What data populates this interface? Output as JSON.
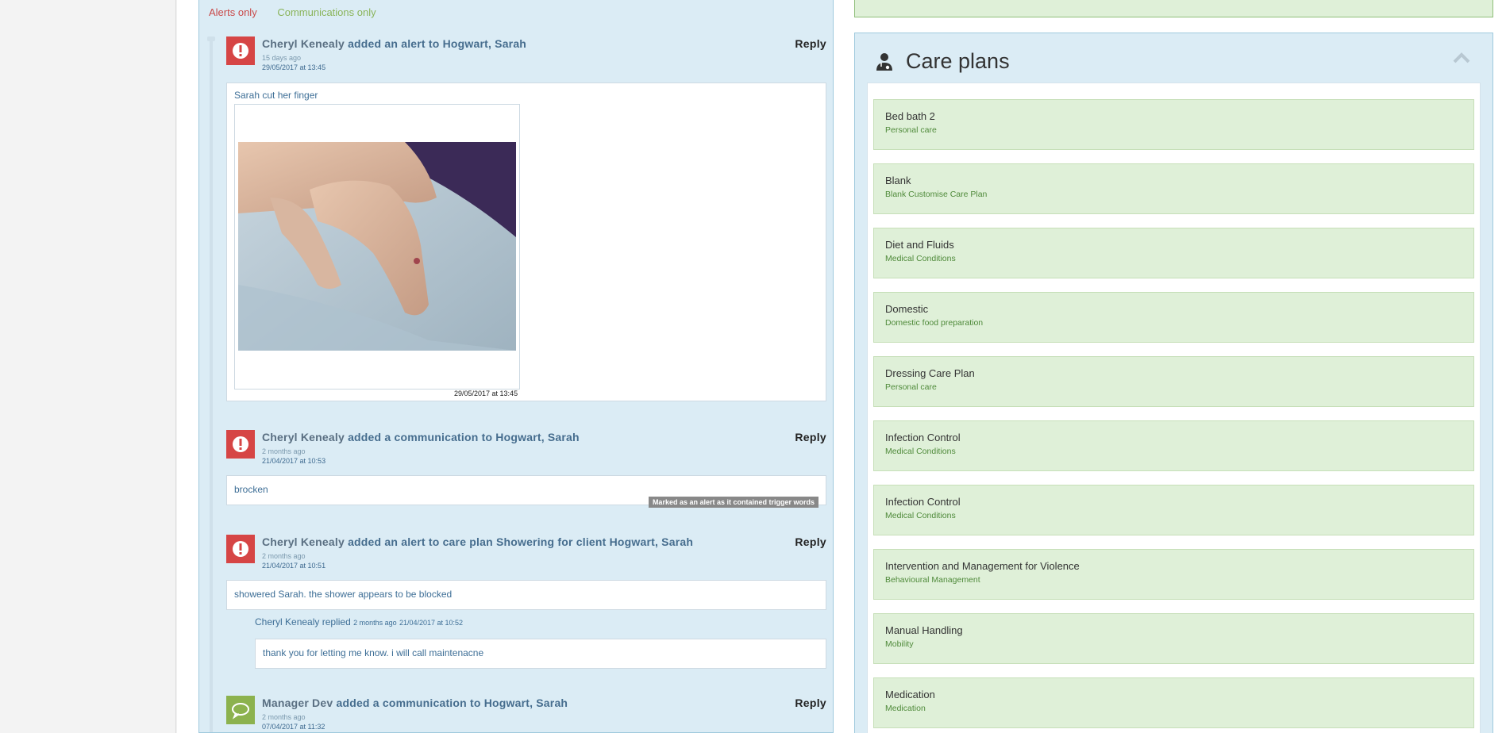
{
  "filters": {
    "alerts_only": "Alerts only",
    "communications_only": "Communications only"
  },
  "feed": {
    "entries": [
      {
        "author": "Cheryl Kenealy",
        "action": "added an alert to Hogwart, Sarah",
        "relative_time": "15 days ago",
        "datetime": "29/05/2017 at 13:45",
        "reply_label": "Reply",
        "message": "Sarah cut her finger",
        "image_date": "29/05/2017 at 13:45"
      },
      {
        "author": "Cheryl Kenealy",
        "action": "added a communication to Hogwart, Sarah",
        "relative_time": "2 months ago",
        "datetime": "21/04/2017 at 10:53",
        "reply_label": "Reply",
        "message": "brocken",
        "trigger_tag": "Marked as an alert as it contained trigger words"
      },
      {
        "author": "Cheryl Kenealy",
        "action": "added an alert to care plan Showering for client Hogwart, Sarah",
        "relative_time": "2 months ago",
        "datetime": "21/04/2017 at 10:51",
        "reply_label": "Reply",
        "message": "showered Sarah. the shower appears to be blocked",
        "reply": {
          "author": "Cheryl Kenealy",
          "verb": "replied",
          "relative_time": "2 months ago",
          "datetime": "21/04/2017 at 10:52",
          "message": "thank you for letting me know. i will call maintenacne"
        }
      },
      {
        "author": "Manager Dev",
        "action": "added a communication to Hogwart, Sarah",
        "relative_time": "2 months ago",
        "datetime": "07/04/2017 at 11:32",
        "reply_label": "Reply"
      }
    ]
  },
  "care_plans": {
    "title": "Care plans",
    "items": [
      {
        "name": "Bed bath 2",
        "category": "Personal care"
      },
      {
        "name": "Blank",
        "category": "Blank Customise Care Plan"
      },
      {
        "name": "Diet and Fluids",
        "category": "Medical Conditions"
      },
      {
        "name": "Domestic",
        "category": "Domestic food preparation"
      },
      {
        "name": "Dressing Care Plan",
        "category": "Personal care"
      },
      {
        "name": "Infection Control",
        "category": "Medical Conditions"
      },
      {
        "name": "Infection Control",
        "category": "Medical Conditions"
      },
      {
        "name": "Intervention and Management for Violence",
        "category": "Behavioural Management"
      },
      {
        "name": "Manual Handling",
        "category": "Mobility"
      },
      {
        "name": "Medication",
        "category": "Medication"
      }
    ]
  },
  "icons": {
    "alert": "exclamation-circle-icon",
    "communication": "speech-bubble-icon",
    "care_plans": "user-doctor-icon",
    "collapse": "chevron-up-icon"
  },
  "colors": {
    "alert_red": "#d64545",
    "communication_green": "#8cb24e",
    "feed_bg": "#dbecf5",
    "care_plan_item_bg": "#dff0d8"
  }
}
